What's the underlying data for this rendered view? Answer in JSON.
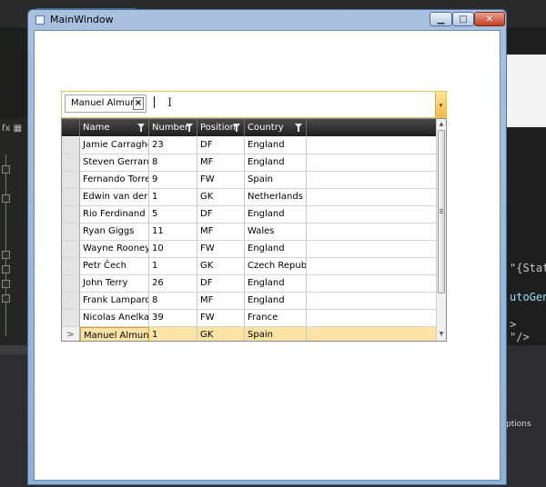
{
  "window": {
    "title": "MainWindow",
    "minimize_symbol": "▁",
    "maximize_symbol": "□",
    "close_symbol": "✕"
  },
  "token_input": {
    "tokens": [
      "Manuel Almunia"
    ],
    "remove_symbol": "×",
    "value": "",
    "dropdown_symbol": "▾"
  },
  "grid": {
    "columns": [
      "Name",
      "Number",
      "Position",
      "Country"
    ],
    "rows": [
      {
        "name": "Jamie Carragher",
        "number": "23",
        "position": "DF",
        "country": "England"
      },
      {
        "name": "Steven Gerrard",
        "number": "8",
        "position": "MF",
        "country": "England"
      },
      {
        "name": "Fernando Torres",
        "number": "9",
        "position": "FW",
        "country": "Spain"
      },
      {
        "name": "Edwin van der Sar",
        "number": "1",
        "position": "GK",
        "country": "Netherlands"
      },
      {
        "name": "Rio Ferdinand",
        "number": "5",
        "position": "DF",
        "country": "England"
      },
      {
        "name": "Ryan Giggs",
        "number": "11",
        "position": "MF",
        "country": "Wales"
      },
      {
        "name": "Wayne Rooney",
        "number": "10",
        "position": "FW",
        "country": "England"
      },
      {
        "name": "Petr Čech",
        "number": "1",
        "position": "GK",
        "country": "Czech Republic"
      },
      {
        "name": "John Terry",
        "number": "26",
        "position": "DF",
        "country": "England"
      },
      {
        "name": "Frank Lampard",
        "number": "8",
        "position": "MF",
        "country": "England"
      },
      {
        "name": "Nicolas Anelka",
        "number": "39",
        "position": "FW",
        "country": "France"
      },
      {
        "name": "Manuel Almunia",
        "number": "1",
        "position": "GK",
        "country": "Spain"
      }
    ],
    "selected_row_marker": ">",
    "scroll_up_symbol": "▲",
    "scroll_down_symbol": "▼"
  },
  "ide": {
    "tool_symbols": "fx ▦",
    "code_line_1": "\"{Stati",
    "code_line_2": "utoGene",
    "code_line_3": ">",
    "code_line_4": "\"/>",
    "bottom_label": "ptions"
  },
  "colors": {
    "selection": "#fbe3a6",
    "selection_border": "#e0a12b",
    "tokenbox_border": "#e8c55b",
    "header_dark": "#1f1f1f"
  }
}
